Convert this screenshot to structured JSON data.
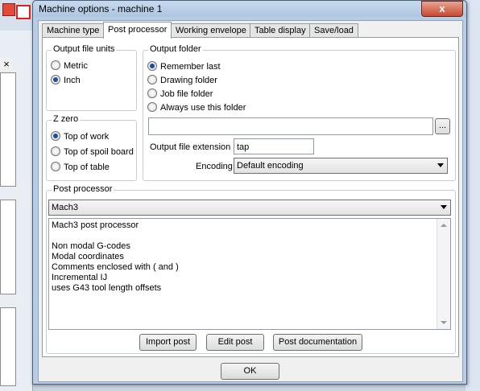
{
  "window": {
    "title": "Machine options - machine 1",
    "close_label": "x"
  },
  "tabs": [
    {
      "label": "Machine type"
    },
    {
      "label": "Post processor"
    },
    {
      "label": "Working envelope"
    },
    {
      "label": "Table display"
    },
    {
      "label": "Save/load"
    }
  ],
  "output_units": {
    "title": "Output file units",
    "options": [
      {
        "label": "Metric",
        "checked": false
      },
      {
        "label": "Inch",
        "checked": true
      }
    ]
  },
  "z_zero": {
    "title": "Z zero",
    "options": [
      {
        "label": "Top of work",
        "checked": true
      },
      {
        "label": "Top of spoil board",
        "checked": false
      },
      {
        "label": "Top of table",
        "checked": false
      }
    ]
  },
  "output_folder": {
    "title": "Output folder",
    "options": [
      {
        "label": "Remember last",
        "checked": true
      },
      {
        "label": "Drawing folder",
        "checked": false
      },
      {
        "label": "Job file folder",
        "checked": false
      },
      {
        "label": "Always use this folder",
        "checked": false
      }
    ],
    "folder_path": "",
    "browse_label": "...",
    "extension_label": "Output file extension",
    "extension_value": "tap",
    "encoding_label": "Encoding",
    "encoding_value": "Default encoding"
  },
  "post_processor": {
    "title": "Post processor",
    "selected": "Mach3",
    "description_lines": [
      "Mach3 post processor",
      "",
      "Non modal G-codes",
      "Modal coordinates",
      "Comments enclosed with ( and )",
      "Incremental IJ",
      "uses G43 tool length offsets"
    ],
    "buttons": {
      "import": "Import post",
      "edit": "Edit post",
      "documentation": "Post documentation"
    }
  },
  "ok_label": "OK"
}
